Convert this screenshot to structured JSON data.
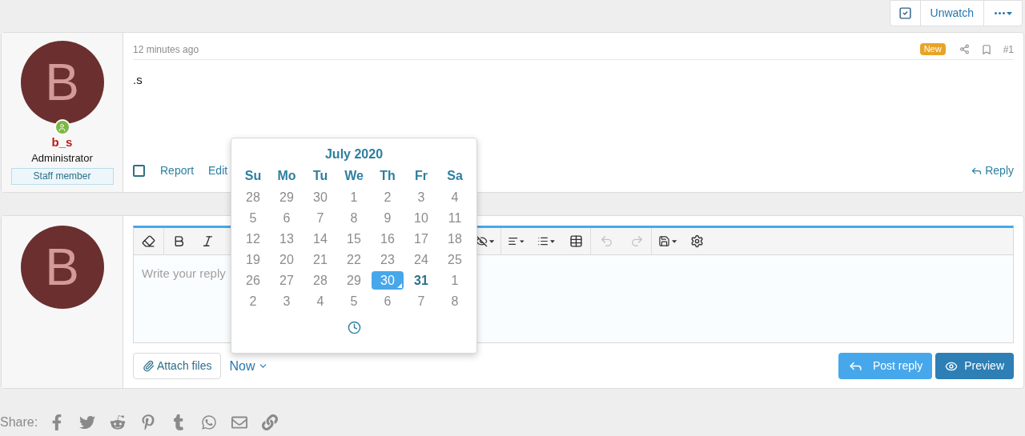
{
  "thread_actions": {
    "unwatch": "Unwatch"
  },
  "post": {
    "avatar_letter": "B",
    "username": "b_s",
    "role": "Administrator",
    "banner": "Staff member",
    "time": "12 minutes ago",
    "badge": "New",
    "number": "#1",
    "body": ".s",
    "select_checked": false,
    "actions": [
      "Report",
      "Edit"
    ],
    "reply": "Reply"
  },
  "reply_box": {
    "avatar_letter": "B",
    "placeholder": "Write your reply",
    "attach": "Attach files",
    "schedule": "Now",
    "post_reply": "Post reply",
    "preview": "Preview"
  },
  "calendar": {
    "month": "July 2020",
    "weekdays": [
      "Su",
      "Mo",
      "Tu",
      "We",
      "Th",
      "Fr",
      "Sa"
    ],
    "weeks": [
      [
        {
          "day": "28",
          "selected": false,
          "today": false
        },
        {
          "day": "29",
          "selected": false,
          "today": false
        },
        {
          "day": "30",
          "selected": false,
          "today": false
        },
        {
          "day": "1",
          "selected": false,
          "today": false
        },
        {
          "day": "2",
          "selected": false,
          "today": false
        },
        {
          "day": "3",
          "selected": false,
          "today": false
        },
        {
          "day": "4",
          "selected": false,
          "today": false
        }
      ],
      [
        {
          "day": "5",
          "selected": false,
          "today": false
        },
        {
          "day": "6",
          "selected": false,
          "today": false
        },
        {
          "day": "7",
          "selected": false,
          "today": false
        },
        {
          "day": "8",
          "selected": false,
          "today": false
        },
        {
          "day": "9",
          "selected": false,
          "today": false
        },
        {
          "day": "10",
          "selected": false,
          "today": false
        },
        {
          "day": "11",
          "selected": false,
          "today": false
        }
      ],
      [
        {
          "day": "12",
          "selected": false,
          "today": false
        },
        {
          "day": "13",
          "selected": false,
          "today": false
        },
        {
          "day": "14",
          "selected": false,
          "today": false
        },
        {
          "day": "15",
          "selected": false,
          "today": false
        },
        {
          "day": "16",
          "selected": false,
          "today": false
        },
        {
          "day": "17",
          "selected": false,
          "today": false
        },
        {
          "day": "18",
          "selected": false,
          "today": false
        }
      ],
      [
        {
          "day": "19",
          "selected": false,
          "today": false
        },
        {
          "day": "20",
          "selected": false,
          "today": false
        },
        {
          "day": "21",
          "selected": false,
          "today": false
        },
        {
          "day": "22",
          "selected": false,
          "today": false
        },
        {
          "day": "23",
          "selected": false,
          "today": false
        },
        {
          "day": "24",
          "selected": false,
          "today": false
        },
        {
          "day": "25",
          "selected": false,
          "today": false
        }
      ],
      [
        {
          "day": "26",
          "selected": false,
          "today": false
        },
        {
          "day": "27",
          "selected": false,
          "today": false
        },
        {
          "day": "28",
          "selected": false,
          "today": false
        },
        {
          "day": "29",
          "selected": false,
          "today": false
        },
        {
          "day": "30",
          "selected": true,
          "today": false
        },
        {
          "day": "31",
          "selected": false,
          "today": true
        },
        {
          "day": "1",
          "selected": false,
          "today": false
        }
      ],
      [
        {
          "day": "2",
          "selected": false,
          "today": false
        },
        {
          "day": "3",
          "selected": false,
          "today": false
        },
        {
          "day": "4",
          "selected": false,
          "today": false
        },
        {
          "day": "5",
          "selected": false,
          "today": false
        },
        {
          "day": "6",
          "selected": false,
          "today": false
        },
        {
          "day": "7",
          "selected": false,
          "today": false
        },
        {
          "day": "8",
          "selected": false,
          "today": false
        }
      ]
    ]
  },
  "share": {
    "label": "Share:"
  }
}
